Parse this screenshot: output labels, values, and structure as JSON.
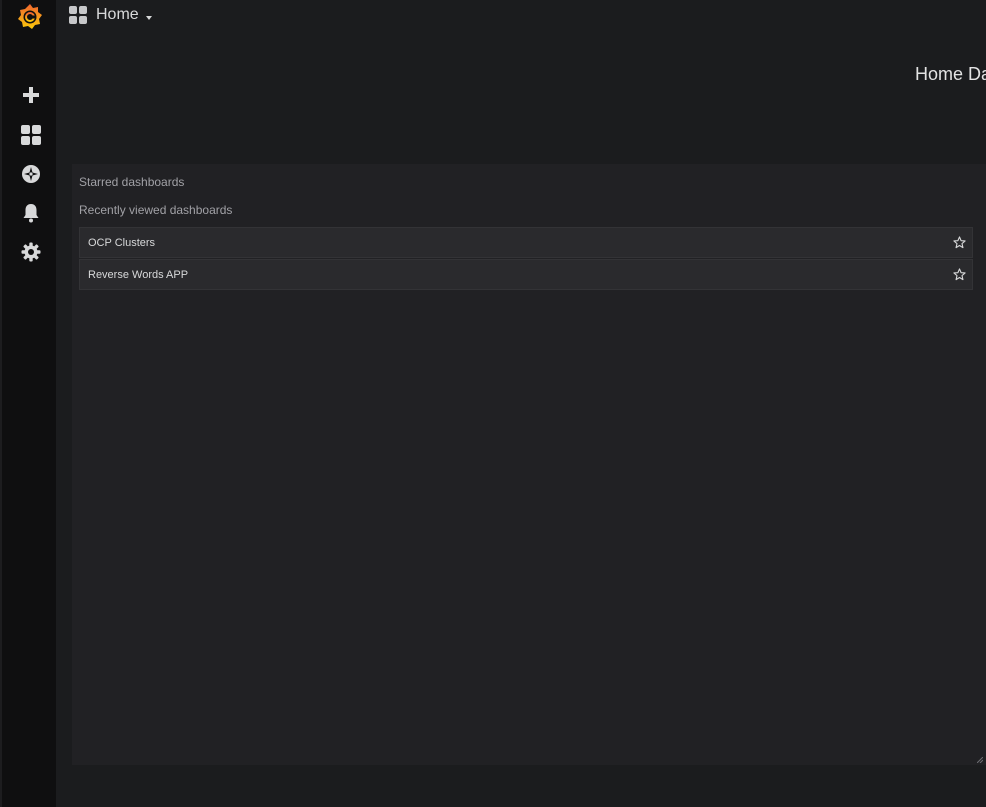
{
  "navbar": {
    "title": "Home"
  },
  "sidemenu": {
    "items": [
      {
        "name": "plus-icon"
      },
      {
        "name": "dashboards-grid-icon"
      },
      {
        "name": "explore-compass-icon"
      },
      {
        "name": "bell-icon"
      },
      {
        "name": "gear-icon"
      }
    ]
  },
  "main": {
    "heading": "Home Da"
  },
  "panel": {
    "starred_label": "Starred dashboards",
    "recent_label": "Recently viewed dashboards",
    "recent_items": [
      {
        "label": "OCP Clusters"
      },
      {
        "label": "Reverse Words APP"
      }
    ]
  },
  "colors": {
    "brand_orange": "#f0652f",
    "brand_yellow": "#fbca0a"
  }
}
